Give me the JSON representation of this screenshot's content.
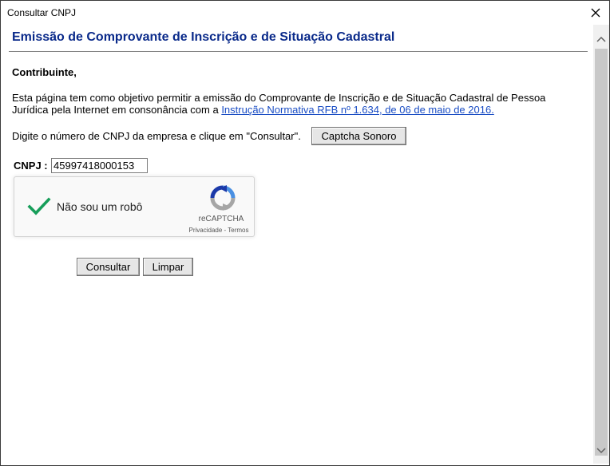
{
  "window": {
    "title": "Consultar CNPJ"
  },
  "page": {
    "heading": "Emissão de Comprovante de Inscrição e de Situação Cadastral",
    "greeting": "Contribuinte,",
    "intro_text": "Esta página tem como objetivo permitir a emissão do Comprovante de Inscrição e de Situação Cadastral de Pessoa Jurídica pela Internet em consonância com a ",
    "intro_link": "Instrução Normativa RFB nº 1.634, de 06 de maio de 2016.",
    "instruction": "Digite o número de CNPJ da empresa e clique em \"Consultar\".",
    "captcha_audio_button": "Captcha Sonoro"
  },
  "form": {
    "cnpj_label": "CNPJ :",
    "cnpj_value": "45997418000153",
    "submit_label": "Consultar",
    "clear_label": "Limpar"
  },
  "recaptcha": {
    "checked": true,
    "label": "Não sou um robô",
    "brand": "reCAPTCHA",
    "privacy_link": "Privacidade",
    "separator": " - ",
    "terms_link": "Termos"
  },
  "colors": {
    "heading": "#0a2a8a",
    "link": "#1a4dc4",
    "checkmark": "#179e5a"
  },
  "icons": {
    "close": "close-icon",
    "scroll_up": "chevron-up-icon",
    "scroll_down": "chevron-down-icon",
    "recaptcha_logo": "recaptcha-logo-icon",
    "check": "checkmark-icon"
  }
}
